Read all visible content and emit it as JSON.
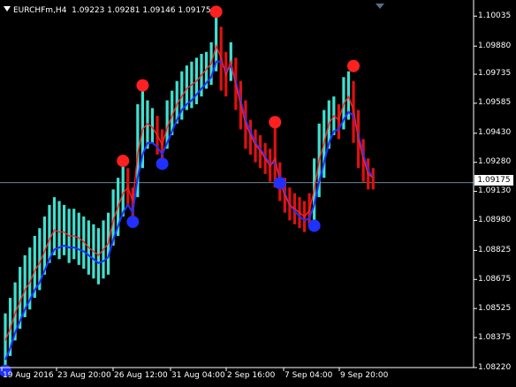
{
  "header": {
    "symbol_tf": "EURCHFm,H4",
    "ohlc": "1.09223 1.09281 1.09146 1.09175"
  },
  "colors": {
    "background": "#000000",
    "axis": "#ffffff",
    "bull_bar": "#40e0d0",
    "bear_bar": "#e01010",
    "ma_fast": "#ff2020",
    "ma_slow": "#2030ff",
    "signal_high": "#ff2020",
    "signal_low": "#2030ff",
    "price_line": "#8fb8d8"
  },
  "current_price_label": "1.09175",
  "chart_data": {
    "type": "bar",
    "title": "EURCHFm,H4",
    "xlabel": "",
    "ylabel": "",
    "ylim": [
      1.0822,
      1.101
    ],
    "y_ticks": [
      "1.10035",
      "1.09880",
      "1.09735",
      "1.09585",
      "1.09430",
      "1.09280",
      "1.09130",
      "1.08980",
      "1.08825",
      "1.08675",
      "1.08525",
      "1.08375",
      "1.08220"
    ],
    "x_ticks": [
      "19 Aug 2016",
      "23 Aug 20:00",
      "26 Aug 12:00",
      "31 Aug 04:00",
      "2 Sep 16:00",
      "7 Sep 04:00",
      "9 Sep 20:00"
    ],
    "current_price": 1.09175,
    "bars": [
      [
        "bull",
        1.0823,
        1.085
      ],
      [
        "bull",
        1.0828,
        1.0858
      ],
      [
        "bull",
        1.0836,
        1.0866
      ],
      [
        "bull",
        1.0842,
        1.0874
      ],
      [
        "bull",
        1.0848,
        1.088
      ],
      [
        "bull",
        1.0852,
        1.0884
      ],
      [
        "bull",
        1.0858,
        1.089
      ],
      [
        "bull",
        1.0862,
        1.0894
      ],
      [
        "bull",
        1.087,
        1.09
      ],
      [
        "bull",
        1.0876,
        1.0906
      ],
      [
        "bull",
        1.088,
        1.091
      ],
      [
        "bull",
        1.0878,
        1.0908
      ],
      [
        "bull",
        1.088,
        1.0906
      ],
      [
        "bull",
        1.0876,
        1.0904
      ],
      [
        "bull",
        1.0878,
        1.0904
      ],
      [
        "bull",
        1.0875,
        1.0902
      ],
      [
        "bull",
        1.0873,
        1.09
      ],
      [
        "bull",
        1.087,
        1.0898
      ],
      [
        "bull",
        1.0868,
        1.0896
      ],
      [
        "bull",
        1.0865,
        1.0894
      ],
      [
        "bull",
        1.0868,
        1.0898
      ],
      [
        "bull",
        1.087,
        1.0902
      ],
      [
        "bull",
        1.0885,
        1.0914
      ],
      [
        "bull",
        1.089,
        1.092
      ],
      [
        "bull",
        1.09,
        1.0926
      ],
      [
        "bear",
        1.0905,
        1.0925
      ],
      [
        "bear",
        1.09,
        1.0915
      ],
      [
        "bull",
        1.091,
        1.0958
      ],
      [
        "bull",
        1.0925,
        1.0965
      ],
      [
        "bull",
        1.0935,
        1.096
      ],
      [
        "bull",
        1.0938,
        1.0956
      ],
      [
        "bear",
        1.0932,
        1.0952
      ],
      [
        "bear",
        1.0928,
        1.0945
      ],
      [
        "bull",
        1.0935,
        1.096
      ],
      [
        "bull",
        1.0942,
        1.0965
      ],
      [
        "bull",
        1.0948,
        1.097
      ],
      [
        "bull",
        1.095,
        1.0975
      ],
      [
        "bull",
        1.0955,
        1.0978
      ],
      [
        "bull",
        1.0956,
        1.098
      ],
      [
        "bull",
        1.0958,
        1.0982
      ],
      [
        "bull",
        1.0962,
        1.0984
      ],
      [
        "bull",
        1.0966,
        1.0985
      ],
      [
        "bull",
        1.0968,
        1.099
      ],
      [
        "bull",
        1.0975,
        1.1003
      ],
      [
        "bear",
        1.0965,
        1.0998
      ],
      [
        "bear",
        1.0962,
        1.0985
      ],
      [
        "bull",
        1.097,
        1.099
      ],
      [
        "bear",
        1.0955,
        1.0982
      ],
      [
        "bear",
        1.0945,
        1.097
      ],
      [
        "bear",
        1.0935,
        1.096
      ],
      [
        "bear",
        1.0932,
        1.095
      ],
      [
        "bear",
        1.0928,
        1.0945
      ],
      [
        "bear",
        1.0925,
        1.0942
      ],
      [
        "bear",
        1.0922,
        1.0938
      ],
      [
        "bear",
        1.0918,
        1.0935
      ],
      [
        "bear",
        1.0915,
        1.0946
      ],
      [
        "bear",
        1.0908,
        1.0928
      ],
      [
        "bear",
        1.0902,
        1.092
      ],
      [
        "bear",
        1.0898,
        1.0915
      ],
      [
        "bear",
        1.0896,
        1.0912
      ],
      [
        "bear",
        1.0894,
        1.091
      ],
      [
        "bear",
        1.0892,
        1.0908
      ],
      [
        "bear",
        1.0895,
        1.0912
      ],
      [
        "bull",
        1.0898,
        1.093
      ],
      [
        "bull",
        1.091,
        1.0948
      ],
      [
        "bull",
        1.092,
        1.0955
      ],
      [
        "bull",
        1.0935,
        1.096
      ],
      [
        "bull",
        1.0942,
        1.0962
      ],
      [
        "bear",
        1.094,
        1.0958
      ],
      [
        "bull",
        1.0945,
        1.0972
      ],
      [
        "bull",
        1.095,
        1.0975
      ],
      [
        "bear",
        1.0938,
        1.097
      ],
      [
        "bear",
        1.0925,
        1.0955
      ],
      [
        "bear",
        1.0918,
        1.094
      ],
      [
        "bear",
        1.0914,
        1.093
      ],
      [
        "bear",
        1.0914,
        1.0925
      ]
    ],
    "ma_fast": [
      1.0836,
      1.0842,
      1.085,
      1.0856,
      1.0862,
      1.0866,
      1.0872,
      1.0876,
      1.0882,
      1.0888,
      1.0893,
      1.0892,
      1.0892,
      1.089,
      1.089,
      1.0889,
      1.0887,
      1.0884,
      1.0882,
      1.088,
      1.0883,
      1.0886,
      1.0898,
      1.0905,
      1.0912,
      1.0915,
      1.0908,
      1.0932,
      1.0945,
      1.0948,
      1.0946,
      1.0942,
      1.0937,
      1.0946,
      1.0952,
      1.0958,
      1.0962,
      1.0966,
      1.0968,
      1.097,
      1.0973,
      1.0976,
      1.0979,
      1.0988,
      1.0982,
      1.0973,
      1.098,
      1.0968,
      1.0958,
      1.0948,
      1.0942,
      1.0937,
      1.0934,
      1.093,
      1.0926,
      1.093,
      1.0918,
      1.0911,
      1.0906,
      1.0904,
      1.0902,
      1.09,
      1.0903,
      1.0914,
      1.0929,
      1.0938,
      1.0948,
      1.0952,
      1.095,
      1.0958,
      1.0962,
      1.0955,
      1.094,
      1.093,
      1.0922,
      1.092
    ],
    "ma_slow": [
      1.0826,
      1.0832,
      1.084,
      1.0846,
      1.0852,
      1.0857,
      1.0862,
      1.0866,
      1.0872,
      1.0878,
      1.0883,
      1.0884,
      1.0885,
      1.0884,
      1.0884,
      1.0883,
      1.0882,
      1.088,
      1.0878,
      1.0876,
      1.0877,
      1.0879,
      1.0888,
      1.0895,
      1.0902,
      1.0906,
      1.0902,
      1.092,
      1.0932,
      1.0938,
      1.0938,
      1.0936,
      1.0932,
      1.0938,
      1.0944,
      1.095,
      1.0955,
      1.0958,
      1.096,
      1.0963,
      1.0966,
      1.0969,
      1.0972,
      1.098,
      1.098,
      1.0975,
      1.0978,
      1.097,
      1.096,
      1.095,
      1.0944,
      1.0938,
      1.0935,
      1.0931,
      1.0927,
      1.0928,
      1.092,
      1.0912,
      1.0906,
      1.0903,
      1.09,
      1.0898,
      1.0899,
      1.0906,
      1.0918,
      1.0928,
      1.0938,
      1.0944,
      1.0945,
      1.095,
      1.0954,
      1.0952,
      1.0942,
      1.0932,
      1.0924,
      1.092
    ],
    "signals_high": [
      [
        24,
        1.0926
      ],
      [
        28,
        1.0965
      ],
      [
        43,
        1.1003
      ],
      [
        55,
        1.0946
      ],
      [
        71,
        1.0975
      ]
    ],
    "signals_low": [
      [
        0,
        1.0823
      ],
      [
        26,
        1.09
      ],
      [
        32,
        1.093
      ],
      [
        56,
        1.092
      ],
      [
        63,
        1.0898
      ]
    ]
  }
}
